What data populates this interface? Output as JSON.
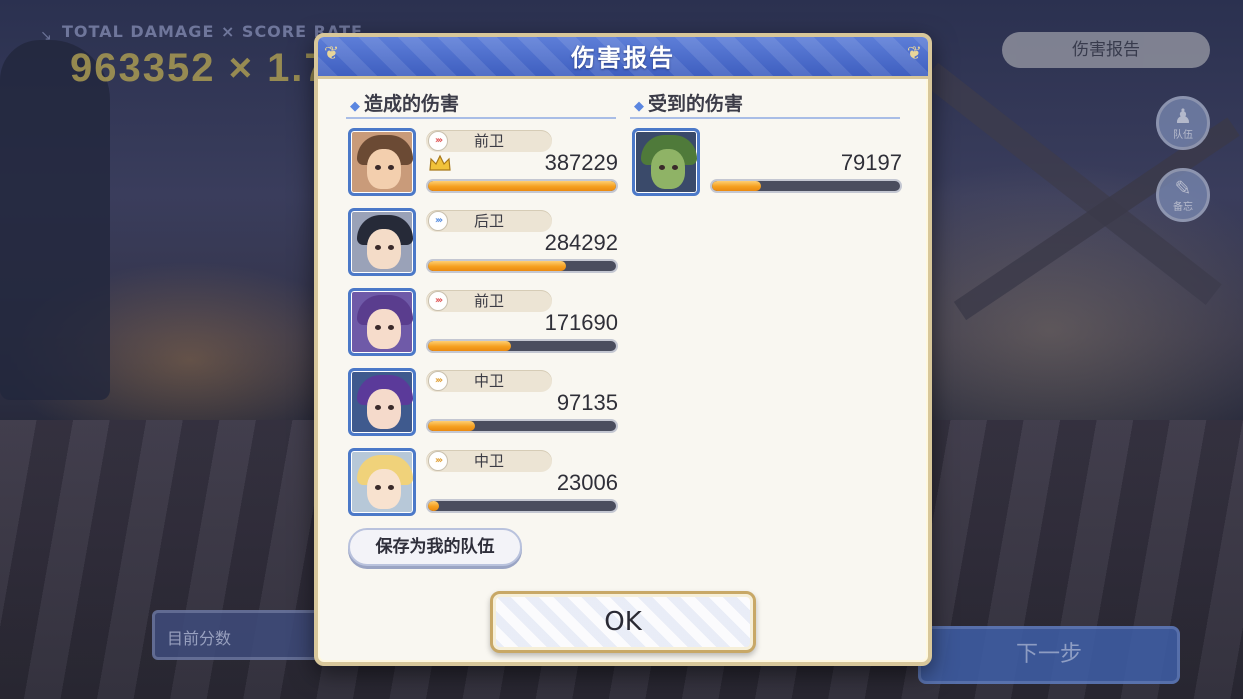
{
  "background": {
    "score_label": "TOTAL DAMAGE × SCORE RATE",
    "score_value": "963352 × 1.7",
    "report_button": "伤害报告",
    "side_buttons": [
      {
        "icon": "team-icon",
        "label": "队伍"
      },
      {
        "icon": "memo-icon",
        "label": "备忘"
      }
    ],
    "team_score_label": "目前分数",
    "next_button": "下一步"
  },
  "modal": {
    "title": "伤害报告",
    "dealt_heading": "造成的伤害",
    "received_heading": "受到的伤害",
    "save_team_label": "保存为我的队伍",
    "ok_label": "OK"
  },
  "dealt": [
    {
      "role": "前卫",
      "damage": "387229",
      "fraction": 1.0,
      "top": true,
      "role_color": "#e05a5a",
      "portrait": {
        "hair": "#6b4a34",
        "skin": "#f3cfae",
        "bg": "#c99b7a"
      }
    },
    {
      "role": "后卫",
      "damage": "284292",
      "fraction": 0.734,
      "top": false,
      "role_color": "#5a8fe0",
      "portrait": {
        "hair": "#262a38",
        "skin": "#f4dcc8",
        "bg": "#9aa2b8"
      }
    },
    {
      "role": "前卫",
      "damage": "171690",
      "fraction": 0.443,
      "top": false,
      "role_color": "#e05a5a",
      "portrait": {
        "hair": "#5a3d8e",
        "skin": "#f6dccb",
        "bg": "#6f5aa8"
      }
    },
    {
      "role": "中卫",
      "damage": "97135",
      "fraction": 0.251,
      "top": false,
      "role_color": "#e0a23a",
      "portrait": {
        "hair": "#5b3a9a",
        "skin": "#f5dacb",
        "bg": "#3f5a8e"
      }
    },
    {
      "role": "中卫",
      "damage": "23006",
      "fraction": 0.059,
      "top": false,
      "role_color": "#e0a23a",
      "portrait": {
        "hair": "#f0d27a",
        "skin": "#f8e2cf",
        "bg": "#b7c8d8"
      }
    }
  ],
  "received": [
    {
      "damage": "79197",
      "fraction": 0.26,
      "portrait": {
        "hair": "#4f7a3a",
        "skin": "#8fb366",
        "bg": "#3a4a6a"
      }
    }
  ],
  "colors": {
    "header_blue": "#4f70cc",
    "frame_gold": "#d8c79a",
    "bar_orange": "#f5a020"
  }
}
